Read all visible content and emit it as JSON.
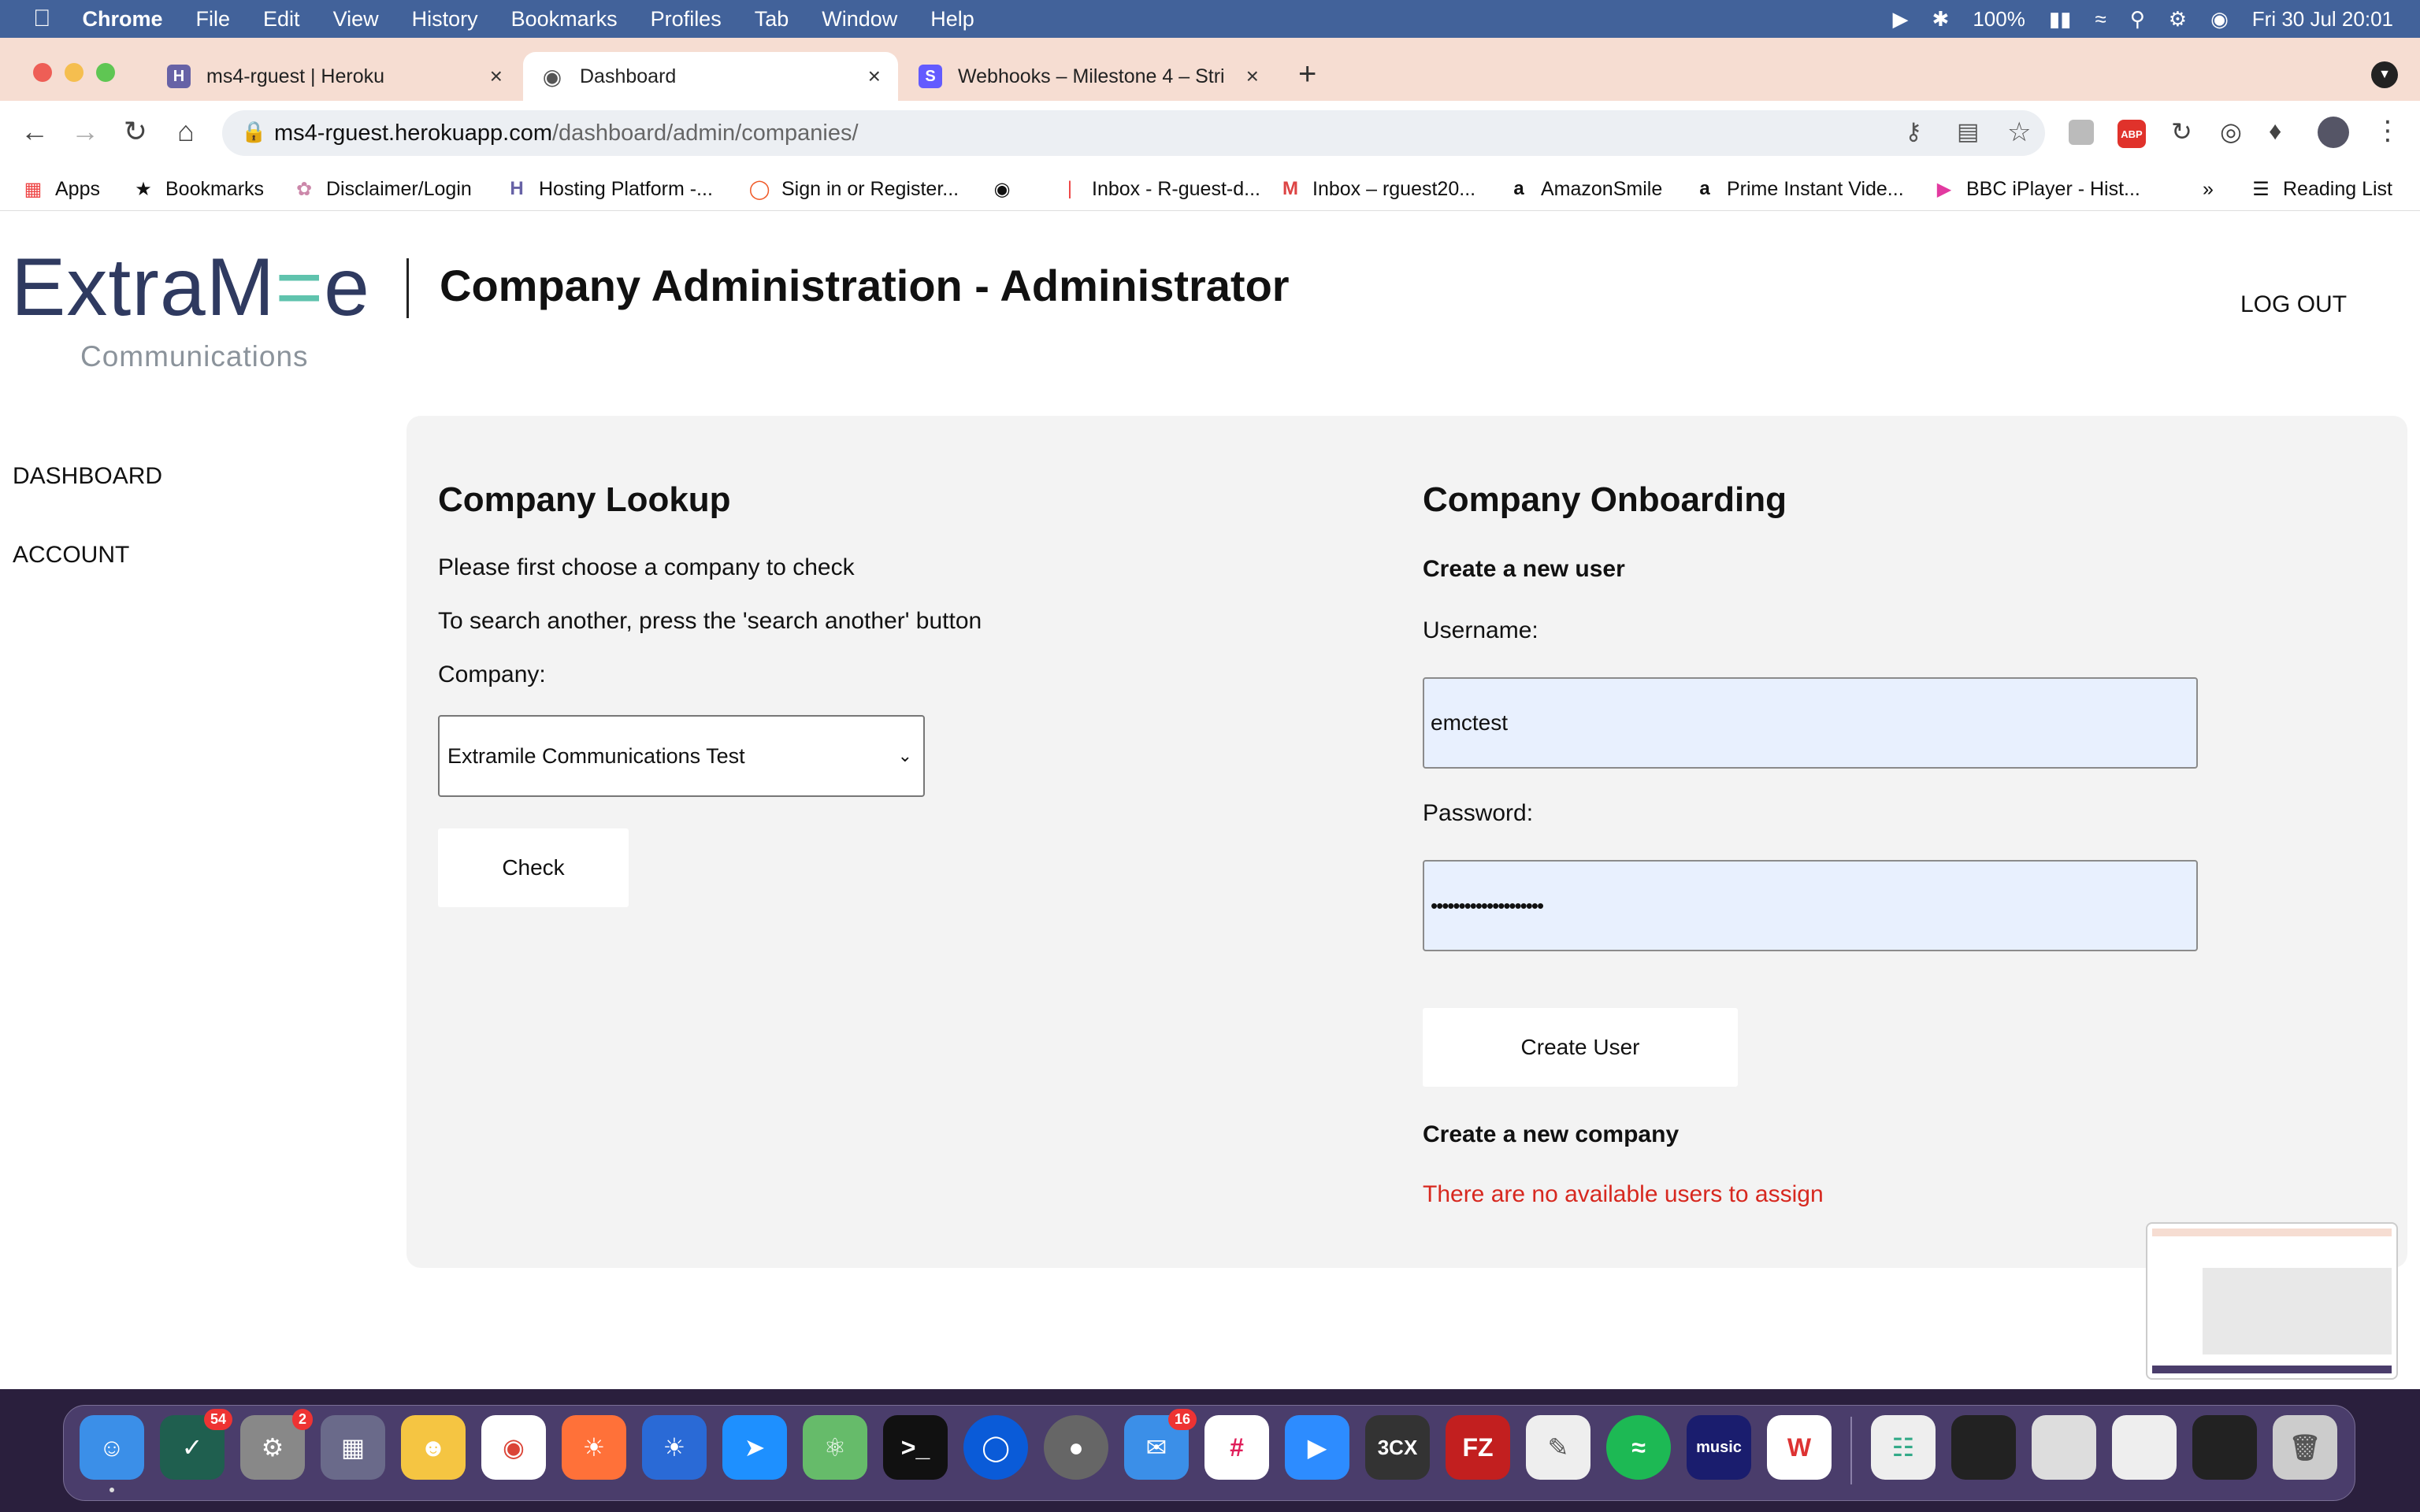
{
  "menubar": {
    "app": "Chrome",
    "items": [
      "File",
      "Edit",
      "View",
      "History",
      "Bookmarks",
      "Profiles",
      "Tab",
      "Window",
      "Help"
    ],
    "battery": "100%",
    "datetime": "Fri 30 Jul  20:01"
  },
  "tabs": [
    {
      "title": "ms4-rguest | Heroku",
      "favicon": "heroku-icon",
      "color": "#6762a6"
    },
    {
      "title": "Dashboard",
      "favicon": "globe-icon",
      "color": "#555555"
    },
    {
      "title": "Webhooks – Milestone 4 – Stri",
      "favicon": "stripe-icon",
      "color": "#635bff"
    }
  ],
  "address": {
    "host": "ms4-rguest.herokuapp.com",
    "path": "/dashboard/admin/companies/"
  },
  "bookmarks": [
    "Apps",
    "Bookmarks",
    "Disclaimer/Login",
    "Hosting Platform -...",
    "Sign in or Register...",
    "",
    "Inbox - R-guest-d...",
    "Inbox – rguest20...",
    "AmazonSmile",
    "Prime Instant Vide...",
    "BBC iPlayer - Hist..."
  ],
  "bookmarks_overflow": "»",
  "reading_list": "Reading List",
  "site": {
    "logo_main_a": "ExtraM",
    "logo_main_accent": "=",
    "logo_main_b": "e",
    "logo_sub": "Communications",
    "page_title": "Company Administration - Administrator",
    "logout": "LOG OUT"
  },
  "sidebar": {
    "items": [
      "DASHBOARD",
      "ACCOUNT"
    ]
  },
  "lookup": {
    "heading": "Company Lookup",
    "instruction1": "Please first choose a company to check",
    "instruction2": "To search another, press the 'search another' button",
    "company_label": "Company:",
    "company_selected": "Extramile Communications Test",
    "check_button": "Check"
  },
  "onboarding": {
    "heading": "Company Onboarding",
    "new_user_heading": "Create a new user",
    "username_label": "Username:",
    "username_value": "emctest",
    "password_label": "Password:",
    "password_value": "••••••••••••••••••••",
    "create_user_button": "Create User",
    "new_company_heading": "Create a new company",
    "no_users_message": "There are no available users to assign"
  },
  "dock": {
    "badges": {
      "things": "54",
      "settings": "2",
      "mail": "16"
    }
  },
  "colors": {
    "error": "#d7281f",
    "logo_accent": "#5fc3ad",
    "logo_text": "#2f3a60",
    "input_bg": "#e8f0fe",
    "menubar": "#42629a",
    "tabbar": "#f6ddd2"
  }
}
